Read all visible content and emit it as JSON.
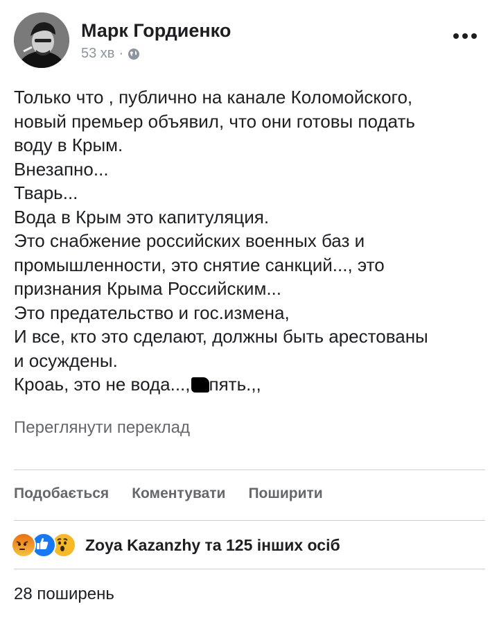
{
  "post": {
    "author": "Марк Гордиенко",
    "time": "53 хв",
    "time_separator": "·",
    "audience_icon": "globe-icon",
    "more_icon": "more-options-icon",
    "lines": [
      "Только что , публично на канале Коломойского,",
      "новый премьер объявил, что они готовы подать",
      "воду в Крым.",
      "Внезапно...",
      "Тварь...",
      "Вода в Крым это капитуляция.",
      "Это снабжение российских военных баз и",
      "промышленности, это снятие санкций..., это",
      "признания Крыма Российским...",
      "Это предательство и гос.измена,",
      "И все, кто это сделают, должны быть арестованы",
      "и осуждены."
    ],
    "last_line_start": "Кроаь, это не вода...,",
    "last_line_end": "пять.,,",
    "translate_link": "Переглянути переклад"
  },
  "actions": {
    "like": "Подобається",
    "comment": "Коментувати",
    "share": "Поширити"
  },
  "reactions": {
    "icons": [
      "angry-icon",
      "like-icon",
      "wow-icon"
    ],
    "text": "Zoya Kazanzhy та 125 інших осіб"
  },
  "shares_count": "28 поширень"
}
